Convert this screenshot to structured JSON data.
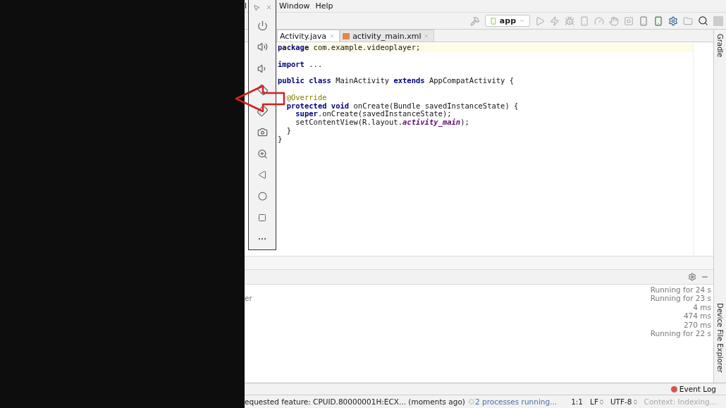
{
  "menu": [
    {
      "label": "l"
    },
    {
      "label": "Window"
    },
    {
      "label": "Help"
    }
  ],
  "run_config": {
    "label": "app"
  },
  "tabs": [
    {
      "label": "Activity.java",
      "selected": true
    },
    {
      "label": "activity_main.xml",
      "selected": false
    }
  ],
  "code_lines": [
    {
      "text": "**package** com.example.videoplayer;",
      "gap_before": false,
      "kind": "code"
    },
    {
      "text": "**import** ...",
      "gap_before": true,
      "kind": "code"
    },
    {
      "text": "**public class** MainActivity **extends** AppCompatActivity {",
      "gap_before": true,
      "kind": "code"
    },
    {
      "text": "  @Override",
      "gap_before": true,
      "kind": "annotation"
    },
    {
      "text": "  **protected void** onCreate(Bundle savedInstanceState) {",
      "gap_before": false,
      "kind": "code"
    },
    {
      "text": "    **super**.onCreate(savedInstanceState);",
      "gap_before": false,
      "kind": "code"
    },
    {
      "text": "    setContentView(R.layout.*activity_main*);",
      "gap_before": false,
      "kind": "code"
    },
    {
      "text": "  }",
      "gap_before": false,
      "kind": "code"
    },
    {
      "text": "}",
      "gap_before": false,
      "kind": "code"
    }
  ],
  "right_tool_windows": [
    {
      "label": "Gradle"
    },
    {
      "label": "Device File Explorer"
    }
  ],
  "bottom_panel": {
    "rows": [
      {
        "right": "Running for 24 s"
      },
      {
        "left": "er",
        "right": "Running for 23 s"
      },
      {
        "right": "4 ms"
      },
      {
        "right": "474 ms"
      },
      {
        "right": "270 ms"
      },
      {
        "right": "Running for 22 s"
      }
    ]
  },
  "event_log": {
    "label": "Event Log"
  },
  "status_bar": {
    "message": "equested feature: CPUID.80000001H:ECX... (moments ago)",
    "progress": "2 processes running...",
    "position": "1:1",
    "line_separator": "LF",
    "encoding": "UTF-8",
    "context": "Context: Indexing..."
  }
}
